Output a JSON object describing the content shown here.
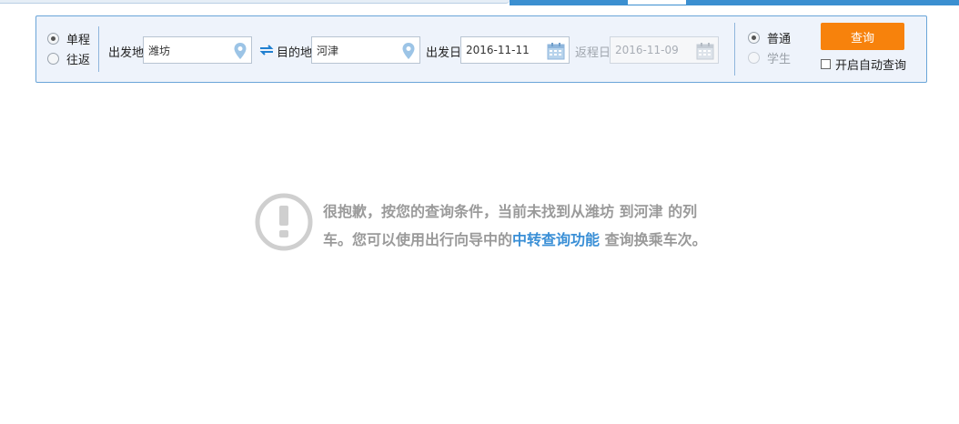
{
  "search": {
    "trip_type": {
      "options": [
        {
          "label": "单程",
          "checked": true
        },
        {
          "label": "往返",
          "checked": false
        }
      ]
    },
    "from": {
      "label": "出发地",
      "value": "潍坊"
    },
    "to": {
      "label": "目的地",
      "value": "河津"
    },
    "depart_date": {
      "label": "出发日",
      "value": "2016-11-11"
    },
    "return_date": {
      "label": "返程日",
      "value": "2016-11-09",
      "disabled": true
    },
    "ticket_type": {
      "options": [
        {
          "label": "普通",
          "checked": true
        },
        {
          "label": "学生",
          "checked": false,
          "disabled": true
        }
      ]
    },
    "query_button": "查询",
    "auto_query_label": "开启自动查询"
  },
  "result": {
    "message_part1": "很抱歉，按您的查询条件，当前未找到从潍坊 到河津 的列车。您可以使用出行向导中的",
    "link_text": "中转查询功能",
    "message_part2": " 查询换乘车次。"
  },
  "colors": {
    "accent_blue": "#3a8fd6",
    "query_orange": "#f7820c",
    "bar_background": "#eef3fb"
  },
  "icons": {
    "location": "pin-icon",
    "swap": "swap-icon",
    "calendar": "calendar-icon",
    "notice": "exclamation-circle-icon"
  }
}
